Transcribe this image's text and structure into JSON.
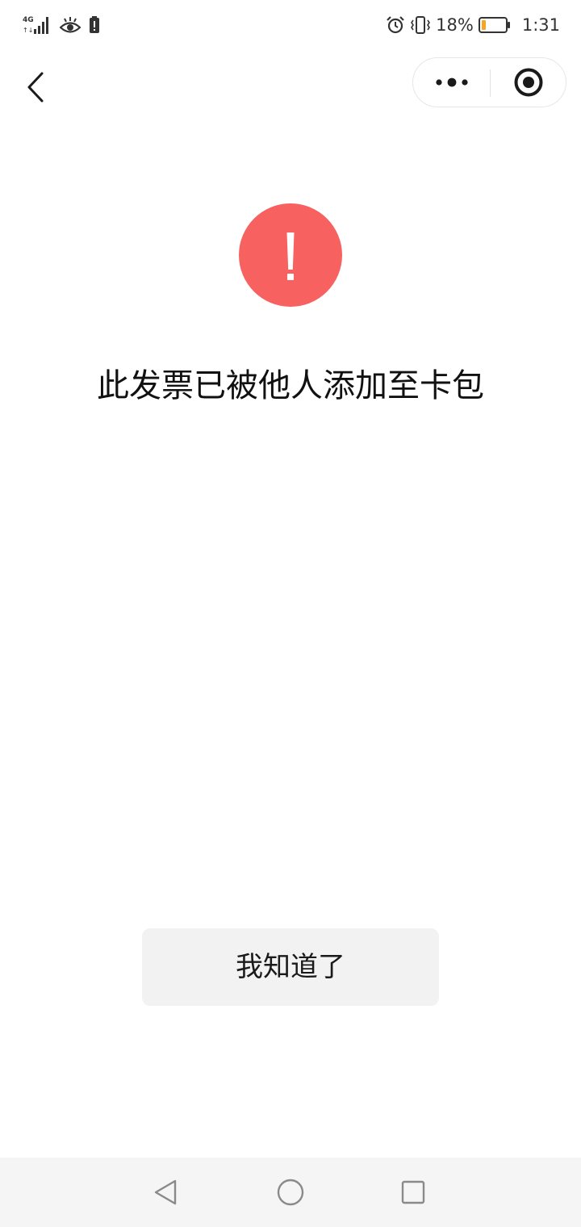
{
  "status_bar": {
    "network_label": "4G",
    "battery_percent_text": "18%",
    "battery_level": 0.18,
    "time": "1:31",
    "icons": [
      "signal-4g-icon",
      "eye-icon",
      "battery-warning-icon",
      "alarm-icon",
      "vibrate-icon",
      "battery-icon"
    ]
  },
  "nav": {
    "back_icon": "chevron-left-icon",
    "capsule": {
      "more_icon": "more-dots-icon",
      "close_icon": "target-close-icon"
    }
  },
  "main": {
    "status_icon": "warning-exclamation-icon",
    "status_color": "#f76260",
    "message": "此发票已被他人添加至卡包",
    "confirm_button_label": "我知道了"
  },
  "system_nav": {
    "icons": [
      "back-triangle-icon",
      "home-circle-icon",
      "recents-square-icon"
    ]
  },
  "colors": {
    "warning": "#f76260",
    "battery_low": "#f5a623",
    "button_bg": "#f2f2f2",
    "text_primary": "#111111"
  }
}
